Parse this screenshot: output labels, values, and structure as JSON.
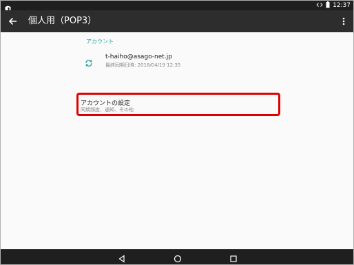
{
  "status_bar": {
    "time": "12:37"
  },
  "toolbar": {
    "title": "個人用（POP3）"
  },
  "content": {
    "section_header": "アカウント",
    "account": {
      "email": "t-haiho@asago-net.jp",
      "last_sync": "最終同期日時: 2018/04/19 12:35"
    },
    "settings": {
      "label": "アカウントの設定",
      "sub": "同期頻度、通知、その他"
    }
  },
  "colors": {
    "accent": "#26a69a",
    "highlight": "#e00000",
    "toolbar_bg": "#2d2d2d",
    "statusbar_bg": "#1f1f1f"
  },
  "icons": {
    "status_left": "shield-icon",
    "status_right": [
      "data-arrows-icon",
      "battery-icon"
    ],
    "toolbar_left": "back-arrow-icon",
    "toolbar_right": "more-vert-icon",
    "account": "sync-icon",
    "nav": [
      "nav-back-icon",
      "nav-home-icon",
      "nav-recents-icon"
    ]
  }
}
